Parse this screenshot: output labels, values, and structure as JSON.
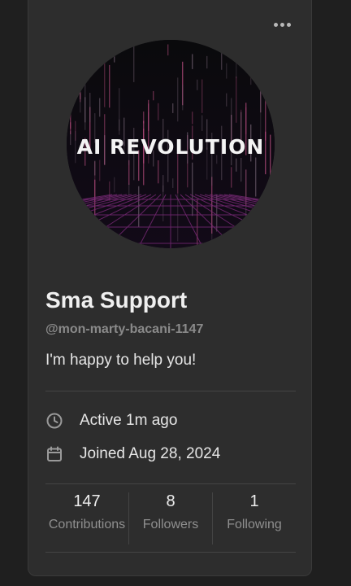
{
  "profile": {
    "name": "Sma Support",
    "handle": "@mon-marty-bacani-1147",
    "bio": "I'm happy to help you!",
    "avatar_text": "AI REVOLUTION"
  },
  "meta": {
    "active": "Active 1m ago",
    "joined": "Joined Aug 28, 2024"
  },
  "stats": [
    {
      "value": "147",
      "label": "Contributions"
    },
    {
      "value": "8",
      "label": "Followers"
    },
    {
      "value": "1",
      "label": "Following"
    }
  ],
  "icons": {
    "more": "more-horizontal-icon",
    "active": "clock-icon",
    "joined": "calendar-icon"
  },
  "colors": {
    "background": "#1f1f1f",
    "card": "#2d2d2d",
    "text": "#e6e6e6",
    "muted": "#8a8a8a"
  }
}
